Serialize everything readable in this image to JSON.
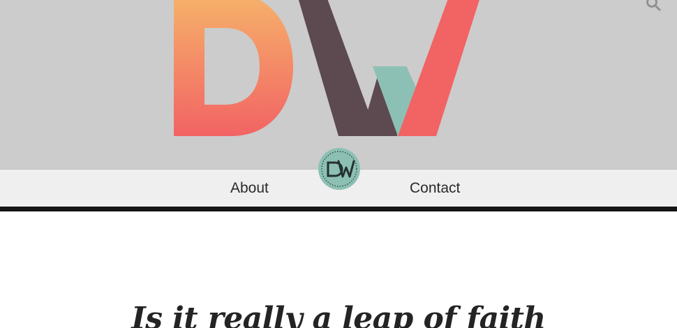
{
  "header": {
    "logo_icon": "dw-logo-icon",
    "search_icon": "search-icon"
  },
  "nav": {
    "items": [
      {
        "label": "About"
      },
      {
        "label": "Contact"
      }
    ],
    "badge_icon": "dw-badge-icon"
  },
  "post": {
    "title": "Is it really a leap of faith"
  },
  "colors": {
    "hero_bg": "#cccccc",
    "nav_bg": "#efefef",
    "nav_rule": "#151515",
    "logo_d_top": "#f6b36a",
    "logo_d_bottom": "#f26364",
    "logo_w_dark": "#5c4a50",
    "logo_w_accent": "#8dc0b4",
    "logo_w_red": "#f26364",
    "badge_bg": "#8cc0b3",
    "title_text": "#242424"
  }
}
